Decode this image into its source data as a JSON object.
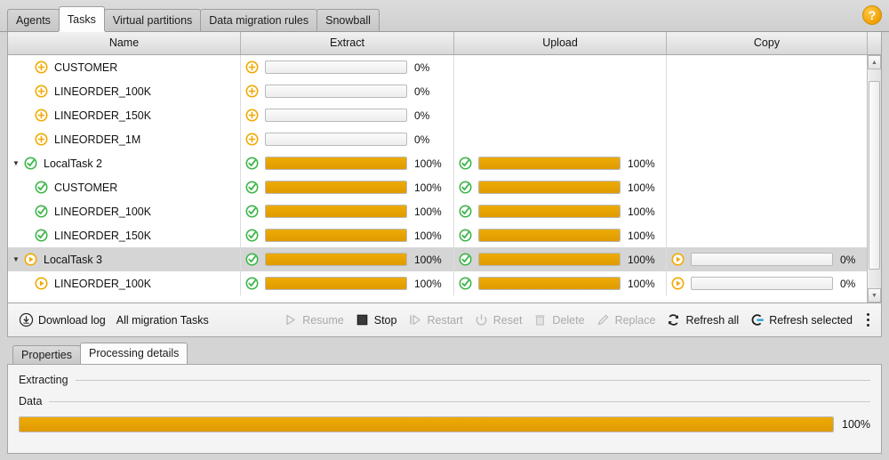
{
  "window": {
    "help_icon": "help-circle-icon",
    "help_label": "?"
  },
  "top_tabs": [
    {
      "label": "Agents",
      "active": false
    },
    {
      "label": "Tasks",
      "active": true
    },
    {
      "label": "Virtual partitions",
      "active": false
    },
    {
      "label": "Data migration rules",
      "active": false
    },
    {
      "label": "Snowball",
      "active": false
    }
  ],
  "table": {
    "columns": [
      {
        "key": "name",
        "label": "Name"
      },
      {
        "key": "extract",
        "label": "Extract"
      },
      {
        "key": "upload",
        "label": "Upload"
      },
      {
        "key": "copy",
        "label": "Copy"
      }
    ],
    "rows": [
      {
        "name": "CUSTOMER",
        "level": "child",
        "twisty": "",
        "selected": false,
        "name_status": "pending",
        "extract": {
          "status": "pending",
          "percent": 0,
          "label": "0%"
        },
        "upload": null,
        "copy": null
      },
      {
        "name": "LINEORDER_100K",
        "level": "child",
        "twisty": "",
        "selected": false,
        "name_status": "pending",
        "extract": {
          "status": "pending",
          "percent": 0,
          "label": "0%"
        },
        "upload": null,
        "copy": null
      },
      {
        "name": "LINEORDER_150K",
        "level": "child",
        "twisty": "",
        "selected": false,
        "name_status": "pending",
        "extract": {
          "status": "pending",
          "percent": 0,
          "label": "0%"
        },
        "upload": null,
        "copy": null
      },
      {
        "name": "LINEORDER_1M",
        "level": "child",
        "twisty": "",
        "selected": false,
        "name_status": "pending",
        "extract": {
          "status": "pending",
          "percent": 0,
          "label": "0%"
        },
        "upload": null,
        "copy": null
      },
      {
        "name": "LocalTask 2",
        "level": "parent",
        "twisty": "expanded",
        "selected": false,
        "name_status": "done",
        "extract": {
          "status": "done",
          "percent": 100,
          "label": "100%"
        },
        "upload": {
          "status": "done",
          "percent": 100,
          "label": "100%"
        },
        "copy": null
      },
      {
        "name": "CUSTOMER",
        "level": "child",
        "twisty": "",
        "selected": false,
        "name_status": "done",
        "extract": {
          "status": "done",
          "percent": 100,
          "label": "100%"
        },
        "upload": {
          "status": "done",
          "percent": 100,
          "label": "100%"
        },
        "copy": null
      },
      {
        "name": "LINEORDER_100K",
        "level": "child",
        "twisty": "",
        "selected": false,
        "name_status": "done",
        "extract": {
          "status": "done",
          "percent": 100,
          "label": "100%"
        },
        "upload": {
          "status": "done",
          "percent": 100,
          "label": "100%"
        },
        "copy": null
      },
      {
        "name": "LINEORDER_150K",
        "level": "child",
        "twisty": "",
        "selected": false,
        "name_status": "done",
        "extract": {
          "status": "done",
          "percent": 100,
          "label": "100%"
        },
        "upload": {
          "status": "done",
          "percent": 100,
          "label": "100%"
        },
        "copy": null
      },
      {
        "name": "LocalTask 3",
        "level": "parent",
        "twisty": "expanded",
        "selected": true,
        "name_status": "running",
        "extract": {
          "status": "done",
          "percent": 100,
          "label": "100%"
        },
        "upload": {
          "status": "done",
          "percent": 100,
          "label": "100%"
        },
        "copy": {
          "status": "running",
          "percent": 0,
          "label": "0%"
        }
      },
      {
        "name": "LINEORDER_100K",
        "level": "child",
        "twisty": "",
        "selected": false,
        "name_status": "running",
        "extract": {
          "status": "done",
          "percent": 100,
          "label": "100%"
        },
        "upload": {
          "status": "done",
          "percent": 100,
          "label": "100%"
        },
        "copy": {
          "status": "running",
          "percent": 0,
          "label": "0%"
        }
      }
    ],
    "scrollbar": {
      "up_arrow": "chevron-up-icon",
      "down_arrow": "chevron-down-icon"
    }
  },
  "toolbar": {
    "download_log": {
      "label": "Download log",
      "icon": "download-circle-icon",
      "enabled": true
    },
    "scope_label": "All migration Tasks",
    "actions": [
      {
        "label": "Resume",
        "icon": "play-icon",
        "enabled": false
      },
      {
        "label": "Stop",
        "icon": "stop-icon",
        "enabled": true
      },
      {
        "label": "Restart",
        "icon": "restart-icon",
        "enabled": false
      },
      {
        "label": "Reset",
        "icon": "power-icon",
        "enabled": false
      },
      {
        "label": "Delete",
        "icon": "trash-icon",
        "enabled": false
      },
      {
        "label": "Replace",
        "icon": "pencil-icon",
        "enabled": false
      },
      {
        "label": "Refresh all",
        "icon": "refresh-icon",
        "enabled": true
      },
      {
        "label": "Refresh selected",
        "icon": "refresh-selected-icon",
        "enabled": true
      }
    ],
    "overflow_icon": "kebab-menu-icon",
    "accent_blue": "#1da0d8"
  },
  "bottom_panel": {
    "tabs": [
      {
        "label": "Properties",
        "active": false
      },
      {
        "label": "Processing details",
        "active": true
      }
    ],
    "group_title": "Extracting",
    "data_label": "Data",
    "progress": {
      "percent": 100,
      "label": "100%"
    }
  },
  "colors": {
    "progress_fill": "#e5a00b",
    "pending_orange": "#f2a900",
    "done_green": "#3cb54a",
    "accent_blue": "#1da0d8"
  }
}
